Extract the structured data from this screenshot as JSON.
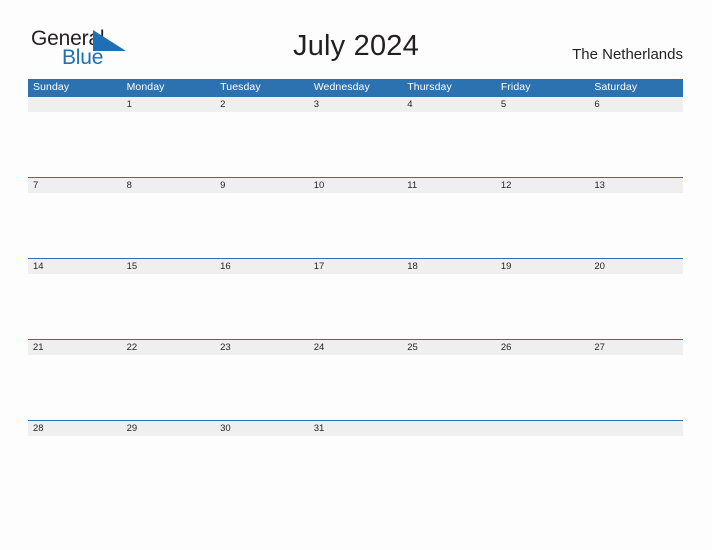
{
  "brand": {
    "line1": "General",
    "line2": "Blue",
    "triangle_icon": "blue-triangle-icon",
    "accent_color": "#1f6fb5",
    "text_color": "#231f20"
  },
  "header": {
    "title": "July 2024",
    "region": "The Netherlands"
  },
  "calendar": {
    "header_bg_color": "#2d72b0",
    "row_strip_color": "#efefef",
    "weekday_headers": [
      "Sunday",
      "Monday",
      "Tuesday",
      "Wednesday",
      "Thursday",
      "Friday",
      "Saturday"
    ],
    "weeks": [
      [
        "",
        "1",
        "2",
        "3",
        "4",
        "5",
        "6"
      ],
      [
        "7",
        "8",
        "9",
        "10",
        "11",
        "12",
        "13"
      ],
      [
        "14",
        "15",
        "16",
        "17",
        "18",
        "19",
        "20"
      ],
      [
        "21",
        "22",
        "23",
        "24",
        "25",
        "26",
        "27"
      ],
      [
        "28",
        "29",
        "30",
        "31",
        "",
        "",
        ""
      ]
    ]
  }
}
